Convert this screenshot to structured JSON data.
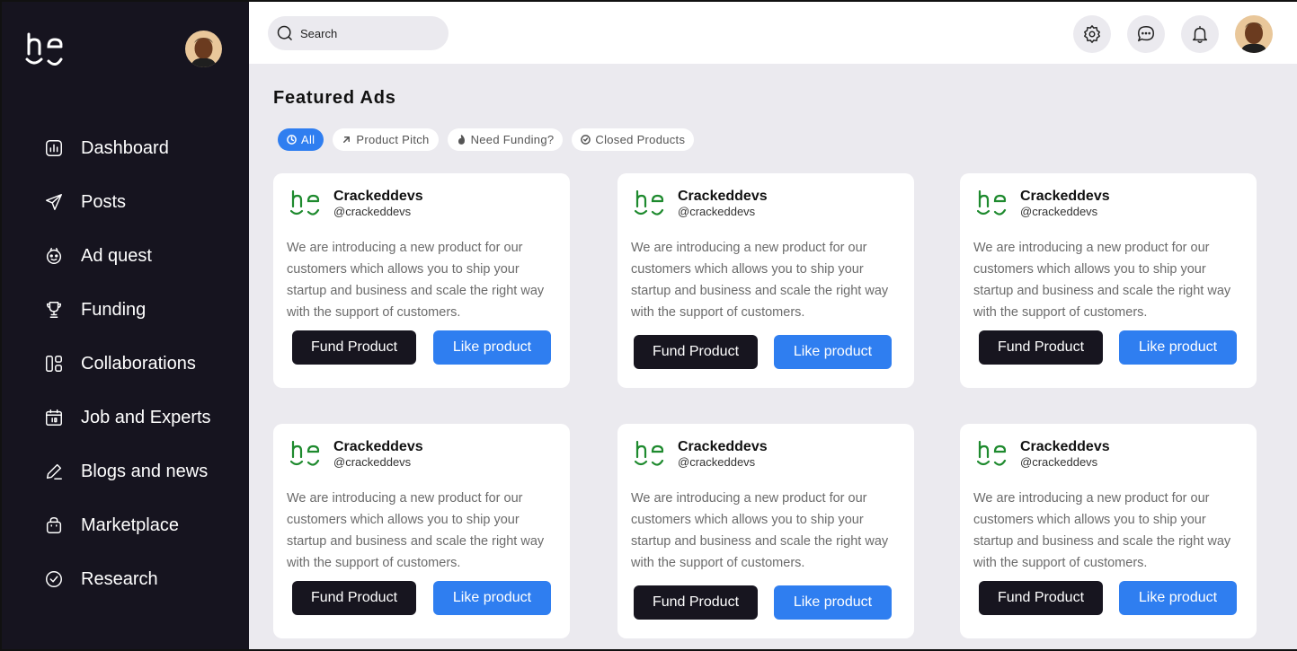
{
  "brand": {
    "logo_icon": "be-logo-icon",
    "logo_color_sidebar": "#ffffff",
    "logo_color_card": "#1e8a2e"
  },
  "sidebar": {
    "items": [
      {
        "label": "Dashboard",
        "icon": "dashboard-icon"
      },
      {
        "label": "Posts",
        "icon": "send-icon"
      },
      {
        "label": "Ad quest",
        "icon": "smiley-icon"
      },
      {
        "label": "Funding",
        "icon": "trophy-icon"
      },
      {
        "label": "Collaborations",
        "icon": "layout-icon"
      },
      {
        "label": "Job and Experts",
        "icon": "calendar-icon"
      },
      {
        "label": "Blogs and news",
        "icon": "pen-icon"
      },
      {
        "label": "Marketplace",
        "icon": "bag-icon"
      },
      {
        "label": "Research",
        "icon": "check-circle-icon"
      }
    ]
  },
  "topbar": {
    "search_placeholder": "Search",
    "buttons": [
      "settings-icon",
      "chat-icon",
      "bell-icon"
    ]
  },
  "main": {
    "title": "Featured Ads",
    "filters": [
      {
        "label": "All",
        "icon": "clock-icon",
        "active": true
      },
      {
        "label": "Product Pitch",
        "icon": "arrow-up-right-icon",
        "active": false
      },
      {
        "label": "Need Funding?",
        "icon": "flame-icon",
        "active": false
      },
      {
        "label": "Closed Products",
        "icon": "check-circle-icon",
        "active": false
      }
    ],
    "cards": [
      {
        "name": "Crackeddevs",
        "handle": "@crackeddevs",
        "text": "We are introducing a new product for our customers which allows you to ship your startup and business and scale the right way with the support of customers.",
        "fund_label": "Fund Product",
        "like_label": "Like product"
      },
      {
        "name": "Crackeddevs",
        "handle": "@crackeddevs",
        "text": "We are introducing a new product for our customers which allows you to ship your startup and business and scale the right way with the support of customers.",
        "fund_label": "Fund Product",
        "like_label": "Like product"
      },
      {
        "name": "Crackeddevs",
        "handle": "@crackeddevs",
        "text": "We are introducing a new product for our customers which allows you to ship your startup and business and scale the right way with the support of customers.",
        "fund_label": "Fund Product",
        "like_label": "Like product"
      },
      {
        "name": "Crackeddevs",
        "handle": "@crackeddevs",
        "text": "We are introducing a new product for our customers which allows you to ship your startup and business and scale the right way with the support of customers.",
        "fund_label": "Fund Product",
        "like_label": "Like product"
      },
      {
        "name": "Crackeddevs",
        "handle": "@crackeddevs",
        "text": "We are introducing a new product for our customers which allows you to ship your startup and business and scale the right way with the support of customers.",
        "fund_label": "Fund Product",
        "like_label": "Like product"
      },
      {
        "name": "Crackeddevs",
        "handle": "@crackeddevs",
        "text": "We are introducing a new product for our customers which allows you to ship your startup and business and scale the right way with the support of customers.",
        "fund_label": "Fund Product",
        "like_label": "Like product"
      }
    ]
  },
  "colors": {
    "sidebar_bg": "#16141f",
    "accent": "#2f7ef0",
    "page_bg": "#ebeaef",
    "dark_button": "#17151f"
  }
}
